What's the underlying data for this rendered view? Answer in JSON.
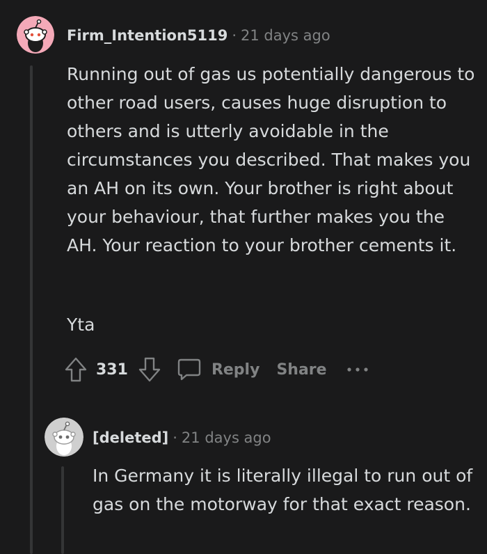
{
  "comments": [
    {
      "username": "Firm_Intention5119",
      "separator": "·",
      "timestamp": "21 days ago",
      "paragraphs": [
        "Running out of gas us potentially dangerous to other road users, causes huge disruption to others and is utterly avoidable in the circumstances you described. That makes you an AH on its own. Your brother is right about your behaviour, that further makes you the AH. Your reaction to your brother cements it.",
        "Yta"
      ],
      "score": "331",
      "actions": {
        "reply": "Reply",
        "share": "Share",
        "more": "···"
      },
      "avatar_color": "#f4a9b8"
    },
    {
      "username": "[deleted]",
      "separator": "·",
      "timestamp": "21 days ago",
      "paragraphs": [
        "In Germany it is literally illegal to run out of gas on the motorway for that exact reason."
      ],
      "avatar_color": "#cfcfcf"
    }
  ],
  "colors": {
    "background": "#1a1a1b",
    "text": "#d7dadc",
    "muted": "#818384",
    "thread_line": "#343536"
  }
}
